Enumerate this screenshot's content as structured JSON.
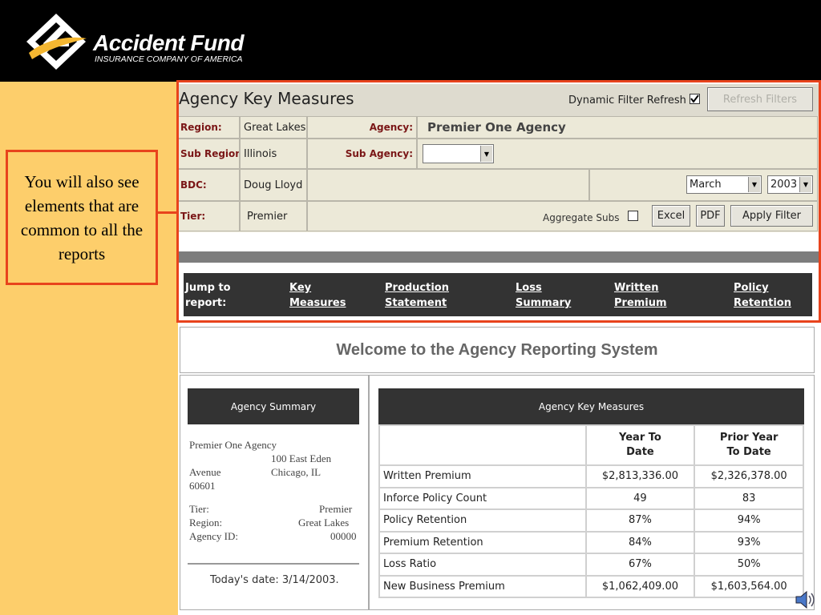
{
  "brand": {
    "name": "Accident Fund",
    "subtitle": "INSURANCE COMPANY OF AMERICA"
  },
  "callout": {
    "text": "You will also see elements that are common to all the reports"
  },
  "header": {
    "title": "Agency Key Measures",
    "dynamic_filter_label": "Dynamic Filter Refresh",
    "dynamic_filter_checked": true,
    "refresh_button": "Refresh Filters"
  },
  "filters": {
    "region_label": "Region:",
    "region_value": "Great Lakes",
    "agency_label": "Agency:",
    "agency_value": "Premier One Agency",
    "sub_region_label": "Sub Region:",
    "sub_region_value": "Illinois",
    "sub_agency_label": "Sub Agency:",
    "sub_agency_value": "",
    "bdc_label": "BDC:",
    "bdc_value": "Doug Lloyd",
    "month_value": "March",
    "year_value": "2003",
    "tier_label": "Tier:",
    "tier_value": "Premier",
    "aggregate_label": "Aggregate Subs",
    "aggregate_checked": false,
    "excel_button": "Excel",
    "pdf_button": "PDF",
    "apply_button": "Apply Filter"
  },
  "jump": {
    "label_line1": "Jump to",
    "label_line2": "report:",
    "links": [
      {
        "line1": "Key",
        "line2": "Measures"
      },
      {
        "line1": "Production",
        "line2": "Statement"
      },
      {
        "line1": "Loss",
        "line2": "Summary"
      },
      {
        "line1": "Written",
        "line2": "Premium"
      },
      {
        "line1": "Policy",
        "line2": "Retention"
      }
    ]
  },
  "welcome": "Welcome to the Agency Reporting System",
  "summary": {
    "title": "Agency Summary",
    "agency_name": "Premier One Agency",
    "address_line1": "100 East Eden",
    "address_line2a": "Avenue",
    "address_line2b": "Chicago, IL",
    "address_line3": "60601",
    "tier_label": "Tier:",
    "tier_value": "Premier",
    "region_label": "Region:",
    "region_value": "Great Lakes",
    "agency_id_label": "Agency ID:",
    "agency_id_value": "00000",
    "date_text": "Today's date: 3/14/2003."
  },
  "key_measures": {
    "title": "Agency Key Measures",
    "col_ytd_line1": "Year To",
    "col_ytd_line2": "Date",
    "col_prior_line1": "Prior Year",
    "col_prior_line2": "To Date",
    "rows": [
      {
        "measure": "Written Premium",
        "ytd": "$2,813,336.00",
        "prior": "$2,326,378.00"
      },
      {
        "measure": "Inforce Policy Count",
        "ytd": "49",
        "prior": "83"
      },
      {
        "measure": "Policy Retention",
        "ytd": "87%",
        "prior": "94%"
      },
      {
        "measure": "Premium Retention",
        "ytd": "84%",
        "prior": "93%"
      },
      {
        "measure": "Loss Ratio",
        "ytd": "67%",
        "prior": "50%"
      },
      {
        "measure": "New Business Premium",
        "ytd": "$1,062,409.00",
        "prior": "$1,603,564.00"
      }
    ]
  },
  "colors": {
    "background": "#fdce6b",
    "highlight": "#e8431c",
    "dark_bar": "#333333",
    "label_red": "#7a1616"
  },
  "icons": [
    "accident-fund-logo-icon",
    "checkbox-icon",
    "dropdown-arrow-icon",
    "speaker-icon"
  ]
}
